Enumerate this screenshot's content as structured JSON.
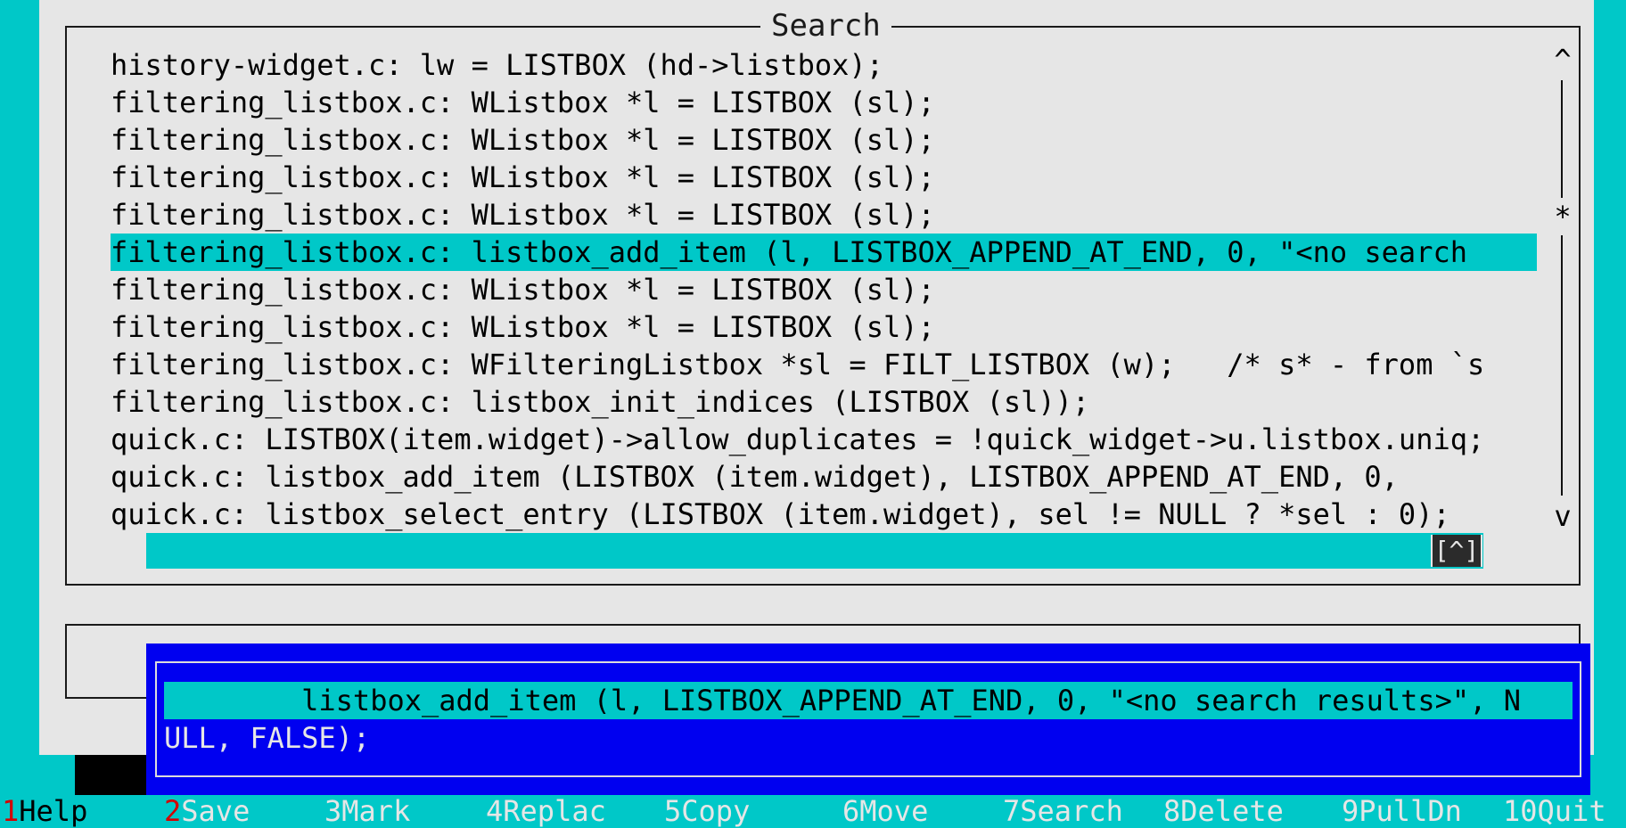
{
  "dialog": {
    "title": "Search",
    "results": [
      "history-widget.c: lw = LISTBOX (hd->listbox);",
      "filtering_listbox.c: WListbox *l = LISTBOX (sl);",
      "filtering_listbox.c: WListbox *l = LISTBOX (sl);",
      "filtering_listbox.c: WListbox *l = LISTBOX (sl);",
      "filtering_listbox.c: WListbox *l = LISTBOX (sl);",
      "filtering_listbox.c: listbox_add_item (l, LISTBOX_APPEND_AT_END, 0, \"<no search",
      "filtering_listbox.c: WListbox *l = LISTBOX (sl);",
      "filtering_listbox.c: WListbox *l = LISTBOX (sl);",
      "filtering_listbox.c: WFilteringListbox *sl = FILT_LISTBOX (w);   /* s* - from `s",
      "filtering_listbox.c: listbox_init_indices (LISTBOX (sl));",
      "quick.c: LISTBOX(item.widget)->allow_duplicates = !quick_widget->u.listbox.uniq;",
      "quick.c: listbox_add_item (LISTBOX (item.widget), LISTBOX_APPEND_AT_END, 0,",
      "quick.c: listbox_select_entry (LISTBOX (item.widget), sel != NULL ? *sel : 0);"
    ],
    "selected_index": 5,
    "scrollbar": {
      "up": "^",
      "thumb": "*",
      "down": "v"
    },
    "hscroll_button": "[^]"
  },
  "popup": {
    "line1": "        listbox_add_item (l, LISTBOX_APPEND_AT_END, 0, \"<no search results>\", N",
    "line2": "ULL, FALSE);"
  },
  "fkeys": [
    {
      "num": "1",
      "label": "Help"
    },
    {
      "num": "2",
      "label": "Save"
    },
    {
      "num": "3",
      "label": "Mark"
    },
    {
      "num": "4",
      "label": "Replac"
    },
    {
      "num": "5",
      "label": "Copy"
    },
    {
      "num": "6",
      "label": "Move"
    },
    {
      "num": "7",
      "label": "Search"
    },
    {
      "num": "8",
      "label": "Delete"
    },
    {
      "num": "9",
      "label": "PullDn"
    },
    {
      "num": "10",
      "label": "Quit"
    }
  ]
}
